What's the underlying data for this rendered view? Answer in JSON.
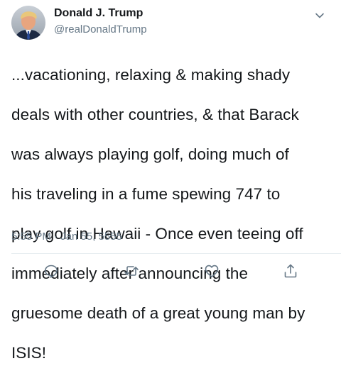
{
  "tweet": {
    "author_name": "Donald J. Trump",
    "author_handle": "@realDonaldTrump",
    "text_lines": [
      "...vacationing, relaxing & making shady",
      "deals with other countries, & that Barack",
      "was always playing golf, doing much of",
      "his traveling in a fume spewing 747 to",
      "play golf in Hawaii - Once even teeing off",
      "immediately after announcing the",
      "gruesome death of a great young man by",
      "ISIS!"
    ],
    "timestamp": "5:55 PM · Jan 55, 5555"
  },
  "icons": {
    "avatar": "profile-photo",
    "menu": "chevron-down-icon",
    "reply": "reply-icon",
    "retweet": "retweet-icon",
    "like": "heart-icon",
    "share": "share-icon"
  },
  "colors": {
    "text": "#14171a",
    "secondary": "#657786",
    "divider": "#e6ecf0"
  }
}
